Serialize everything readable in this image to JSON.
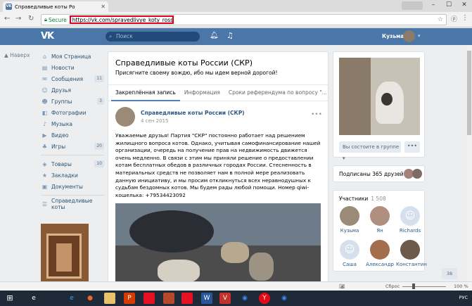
{
  "browser": {
    "tab_title": "Справедливые коты Ро",
    "tab_favicon": "VK",
    "secure_label": "Secure",
    "url": "https://vk.com/spravedlivye_koty_rossii"
  },
  "header": {
    "logo": "VK",
    "search_placeholder": "Поиск",
    "user_name": "Кузьма"
  },
  "left_menu": {
    "back_label": "Наверх",
    "items": [
      {
        "label": "Моя Страница",
        "icon": "home-icon",
        "count": ""
      },
      {
        "label": "Новости",
        "icon": "news-icon",
        "count": ""
      },
      {
        "label": "Сообщения",
        "icon": "message-icon",
        "count": "11"
      },
      {
        "label": "Друзья",
        "icon": "friends-icon",
        "count": ""
      },
      {
        "label": "Группы",
        "icon": "groups-icon",
        "count": "3"
      },
      {
        "label": "Фотографии",
        "icon": "camera-icon",
        "count": ""
      },
      {
        "label": "Музыка",
        "icon": "music-icon",
        "count": ""
      },
      {
        "label": "Видео",
        "icon": "video-icon",
        "count": ""
      },
      {
        "label": "Игры",
        "icon": "games-icon",
        "count": "20"
      }
    ],
    "items2": [
      {
        "label": "Товары",
        "icon": "goods-icon",
        "count": "10"
      },
      {
        "label": "Закладки",
        "icon": "bookmark-icon",
        "count": ""
      },
      {
        "label": "Документы",
        "icon": "document-icon",
        "count": ""
      }
    ],
    "items3": [
      {
        "label": "Справедливые коты",
        "icon": "group-icon",
        "count": ""
      }
    ]
  },
  "group": {
    "name": "Справедливые коты России (СКР)",
    "status": "Присягните своему вождю, ибо мы идем верной дорогой!",
    "tabs": [
      "Закреплённая запись",
      "Информация",
      "Сроки референдума по вопросу \"..."
    ]
  },
  "post": {
    "author": "Справедливые коты России (СКР)",
    "date": "4 сен 2015",
    "text": "Уважаемые друзья! Партия \"СКР\" постоянно работает над решением жилищного вопроса котов. Однако, учитывая самофинансирование нашей организации, очередь на получение прав на недвижимость движется очень медленно. В связи с этим мы приняли решение о предоставлении котам бесплатных обедов в различных городах России. Стесненность в материальных средств не позволяет нам в полной мере реализовать данную инициативу, и мы просим откликнуться всех неравнодушных к судьбам бездомных котов. Мы будем рады любой помощи. Номер qiwi-кошелька: +79534423092"
  },
  "right": {
    "join_button": "Вы состоите в группе",
    "more_button": "•••",
    "subscribed": "Подписаны 365 друзей",
    "participants_label": "Участники",
    "participants_count": "1 508",
    "members": [
      {
        "name": "Кузьма",
        "color": "#9a8a78"
      },
      {
        "name": "Ян",
        "color": "#b08f7e"
      },
      {
        "name": "Richards",
        "color": "default"
      },
      {
        "name": "Саша",
        "color": "default"
      },
      {
        "name": "Александр",
        "color": "#a46d4c"
      },
      {
        "name": "Константин",
        "color": "#6d5a4b"
      }
    ],
    "page_counter": "38"
  },
  "statusbar": {
    "zoom_label": "Сброс",
    "zoom_value": "100 %"
  },
  "taskbar": {
    "lang": "РУС",
    "time": "19:06"
  }
}
